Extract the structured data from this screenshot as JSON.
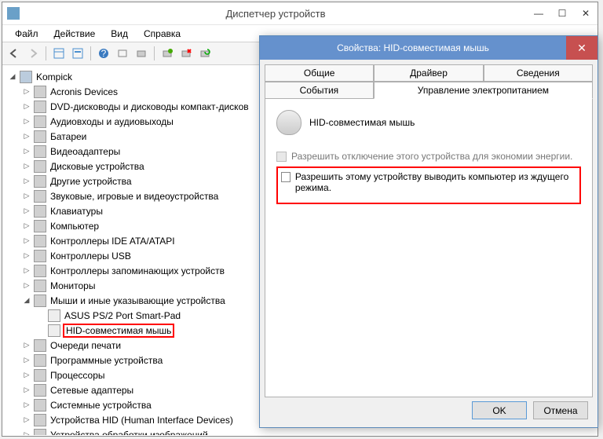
{
  "window": {
    "title": "Диспетчер устройств",
    "menu": {
      "file": "Файл",
      "action": "Действие",
      "view": "Вид",
      "help": "Справка"
    }
  },
  "tree": {
    "root": "Kompick",
    "items": [
      "Acronis Devices",
      "DVD-дисководы и дисководы компакт-дисков",
      "Аудиовходы и аудиовыходы",
      "Батареи",
      "Видеоадаптеры",
      "Дисковые устройства",
      "Другие устройства",
      "Звуковые, игровые и видеоустройства",
      "Клавиатуры",
      "Компьютер",
      "Контроллеры IDE ATA/ATAPI",
      "Контроллеры USB",
      "Контроллеры запоминающих устройств",
      "Мониторы"
    ],
    "mice_category": "Мыши и иные указывающие устройства",
    "mice_children": [
      "ASUS PS/2 Port Smart-Pad",
      "HID-совместимая мышь"
    ],
    "items_after": [
      "Очереди печати",
      "Программные устройства",
      "Процессоры",
      "Сетевые адаптеры",
      "Системные устройства",
      "Устройства HID (Human Interface Devices)",
      "Устройства обработки изображений"
    ]
  },
  "dialog": {
    "title": "Свойства: HID-совместимая мышь",
    "tabs": {
      "general": "Общие",
      "driver": "Драйвер",
      "details": "Сведения",
      "events": "События",
      "power": "Управление электропитанием"
    },
    "device_name": "HID-совместимая мышь",
    "check1": "Разрешить отключение этого устройства для экономии энергии.",
    "check2": "Разрешить этому устройству выводить компьютер из ждущего режима.",
    "ok": "OK",
    "cancel": "Отмена"
  }
}
